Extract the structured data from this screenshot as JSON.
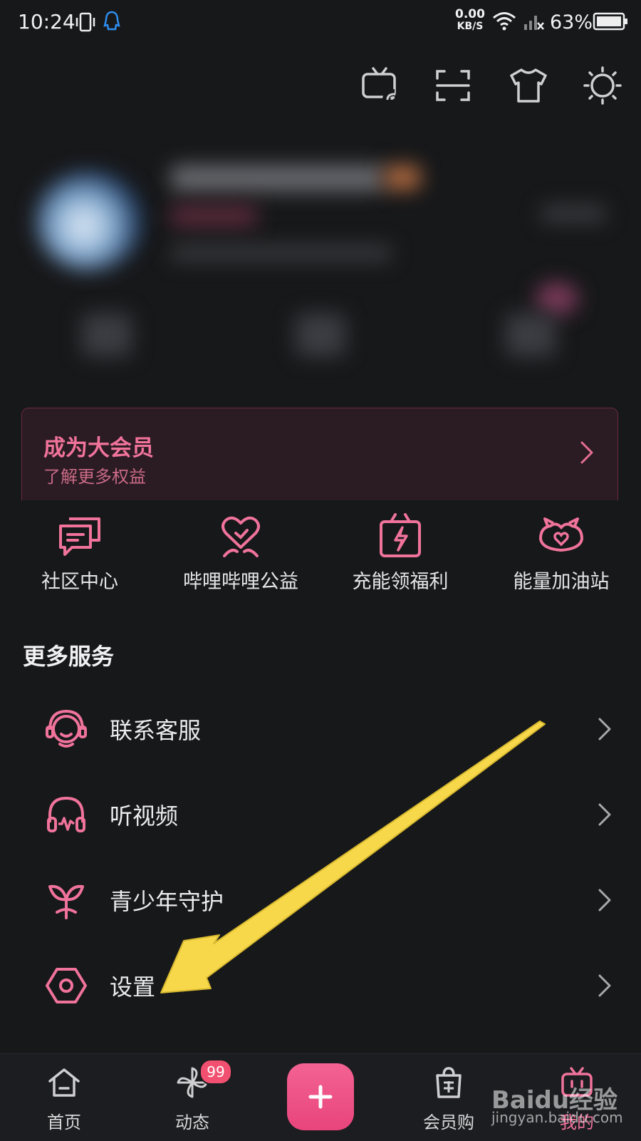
{
  "status_bar": {
    "time": "10:24",
    "net_speed_value": "0.00",
    "net_speed_unit": "KB/S",
    "battery": "63%"
  },
  "top_icons": [
    "tv-cast-icon",
    "scan-icon",
    "tshirt-icon",
    "sun-icon"
  ],
  "vip_banner": {
    "title": "成为大会员",
    "subtitle": "了解更多权益"
  },
  "quick_entries": [
    {
      "label": "社区中心",
      "icon": "community-chat-icon"
    },
    {
      "label": "哔哩哔哩公益",
      "icon": "charity-heart-icon"
    },
    {
      "label": "充能领福利",
      "icon": "gift-energy-icon"
    },
    {
      "label": "能量加油站",
      "icon": "energy-station-icon"
    }
  ],
  "more_services": {
    "title": "更多服务",
    "items": [
      {
        "label": "联系客服",
        "icon": "customer-service-icon"
      },
      {
        "label": "听视频",
        "icon": "headphones-icon"
      },
      {
        "label": "青少年守护",
        "icon": "sprout-icon"
      },
      {
        "label": "设置",
        "icon": "settings-hexagon-icon"
      }
    ]
  },
  "bottom_nav": {
    "items": [
      {
        "label": "首页",
        "icon": "home-icon"
      },
      {
        "label": "动态",
        "icon": "pinwheel-icon",
        "badge": "99"
      },
      {
        "label": "",
        "icon": "plus-icon"
      },
      {
        "label": "会员购",
        "icon": "shopping-bag-icon"
      },
      {
        "label": "我的",
        "icon": "bilibili-tv-icon"
      }
    ]
  },
  "watermark": {
    "brand": "Baidu经验",
    "url": "jingyan.baidu.com"
  },
  "colors": {
    "accent": "#f0739b",
    "background": "#17181a",
    "arrow": "#f7d84a"
  }
}
